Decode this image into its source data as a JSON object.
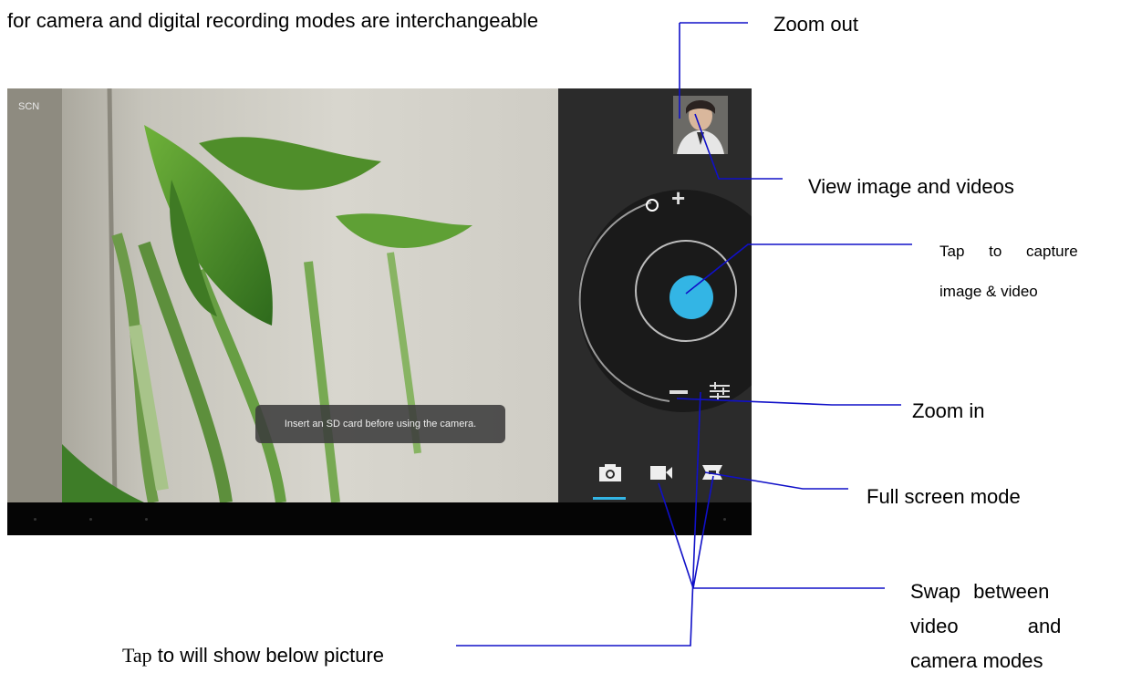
{
  "header": {
    "caption": "for camera and digital recording modes are interchangeable"
  },
  "labels": {
    "zoom_out": "Zoom out",
    "view_media": "View image and videos",
    "capture_line1": "Tap to capture",
    "capture_line2": "image & video",
    "zoom_in": "Zoom in",
    "full_screen": "Full screen mode",
    "swap_line1": "Swap between",
    "swap_line2": "video and",
    "swap_line3": "camera modes",
    "tap_word": "Tap",
    "tap_rest": " to will show below picture"
  },
  "camera_screen": {
    "scene_label": "SCN",
    "toast": "Insert an SD card before using the camera.",
    "icons": [
      "zoom-plus-icon",
      "zoom-minus-icon",
      "settings-sliders-icon",
      "camera-mode-icon",
      "video-mode-icon",
      "panorama-mode-icon"
    ]
  },
  "colors": {
    "accent": "#33b5e5",
    "callout_line": "#1010c8",
    "panel": "#2b2b2b"
  }
}
